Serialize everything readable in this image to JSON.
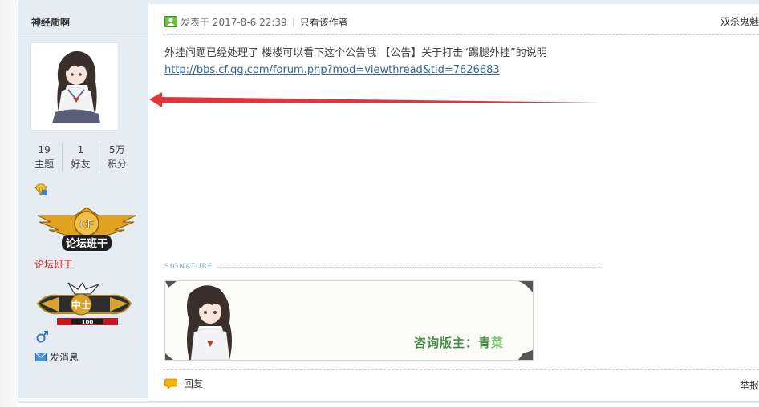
{
  "user": {
    "name": "神经质啊",
    "stats": [
      {
        "value": "19",
        "label": "主题"
      },
      {
        "value": "1",
        "label": "好友"
      },
      {
        "value": "5万",
        "label": "积分"
      }
    ],
    "badge_text": "论坛班干",
    "group": "论坛班干",
    "rank_badge": {
      "logo": "CF",
      "title": "中士",
      "level": "100"
    },
    "send_message": "发消息",
    "gender_icon": "male-icon"
  },
  "post": {
    "posted_label": "发表于 2017-8-6 22:39",
    "view_author_only": "只看该作者",
    "floor_label": "双杀鬼魅",
    "content_text": "外挂问题已经处理了 楼楼可以看下这个公告哦 【公告】关于打击“踢腿外挂”的说明",
    "content_link": "http://bbs.cf.qq.com/forum.php?mod=viewthread&tid=7626683",
    "signature_label": "SIGNATURE",
    "signature_text_main": "咨询版主：青",
    "signature_text_tail": "菜",
    "reply_label": "回复",
    "footer_right": "举报"
  },
  "colors": {
    "sidebar_bg": "#e5edf2",
    "group_color": "#e01d1d",
    "link_color": "#336699",
    "arrow_color": "#e8323a"
  }
}
